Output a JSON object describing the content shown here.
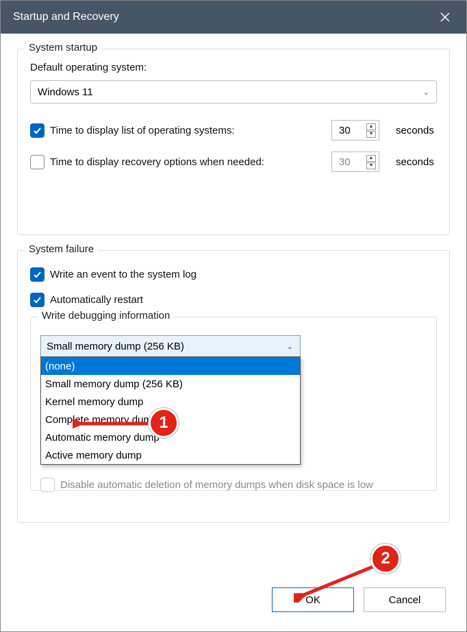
{
  "window": {
    "title": "Startup and Recovery"
  },
  "startup": {
    "legend": "System startup",
    "default_os_label": "Default operating system:",
    "default_os_value": "Windows 11",
    "time_os_list_label": "Time to display list of operating systems:",
    "time_os_list_value": "30",
    "time_recovery_label": "Time to display recovery options when needed:",
    "time_recovery_value": "30",
    "seconds": "seconds"
  },
  "failure": {
    "legend": "System failure",
    "write_event_label": "Write an event to the system log",
    "auto_restart_label": "Automatically restart",
    "write_debug_legend": "Write debugging information",
    "combo_selected": "Small memory dump (256 KB)",
    "options": [
      "(none)",
      "Small memory dump (256 KB)",
      "Kernel memory dump",
      "Complete memory dump",
      "Automatic memory dump",
      "Active memory dump"
    ],
    "disable_auto_delete": "Disable automatic deletion of memory dumps when disk space is low"
  },
  "buttons": {
    "ok": "OK",
    "cancel": "Cancel"
  },
  "annotations": {
    "one": "1",
    "two": "2"
  }
}
